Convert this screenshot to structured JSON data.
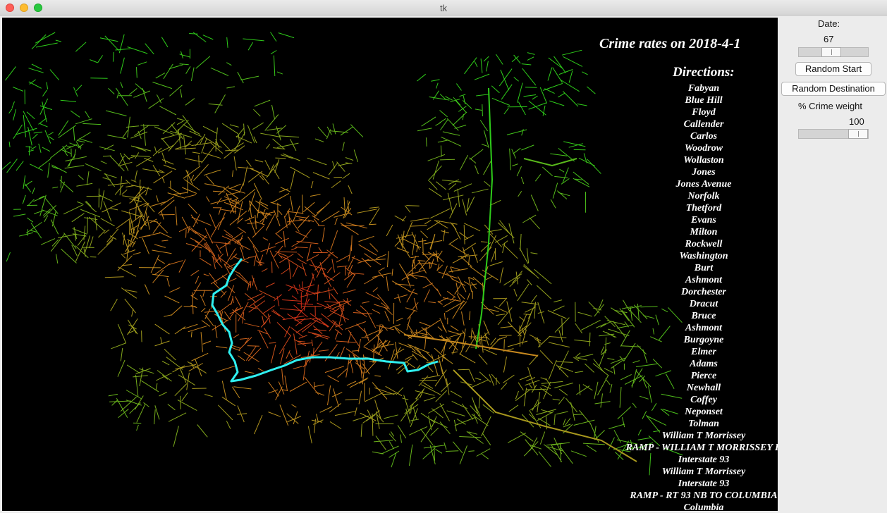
{
  "window": {
    "title": "tk"
  },
  "map": {
    "title": "Crime rates on 2018-4-1",
    "directions_heading": "Directions:",
    "directions": [
      "Fabyan",
      "Blue Hill",
      "Floyd",
      "Callender",
      "Carlos",
      "Woodrow",
      "Wollaston",
      "Jones",
      "Jones Avenue",
      "Norfolk",
      "Thetford",
      "Evans",
      "Milton",
      "Rockwell",
      "Washington",
      "Burt",
      "Ashmont",
      "Dorchester",
      "Dracut",
      "Bruce",
      "Ashmont",
      "Burgoyne",
      "Elmer",
      "Adams",
      "Pierce",
      "Newhall",
      "Coffey",
      "Neponset",
      "Tolman",
      "William T Morrissey",
      "RAMP - WILLIAM T MORRISSEY B",
      "Interstate 93",
      "William T Morrissey",
      "Interstate 93",
      "RAMP - RT 93 NB TO COLUMBIA",
      "Columbia"
    ],
    "colors": {
      "background": "#000000",
      "low_crime": "#2ecc1a",
      "mid_crime": "#c88a1e",
      "high_crime": "#d42418",
      "route": "#2ff0f0"
    }
  },
  "controls": {
    "date_label": "Date:",
    "date_value": "67",
    "date_fraction": 0.45,
    "random_start_label": "Random Start",
    "random_destination_label": "Random Destination",
    "crime_weight_label": "% Crime weight",
    "crime_weight_value": "100",
    "crime_weight_fraction": 1.0
  }
}
